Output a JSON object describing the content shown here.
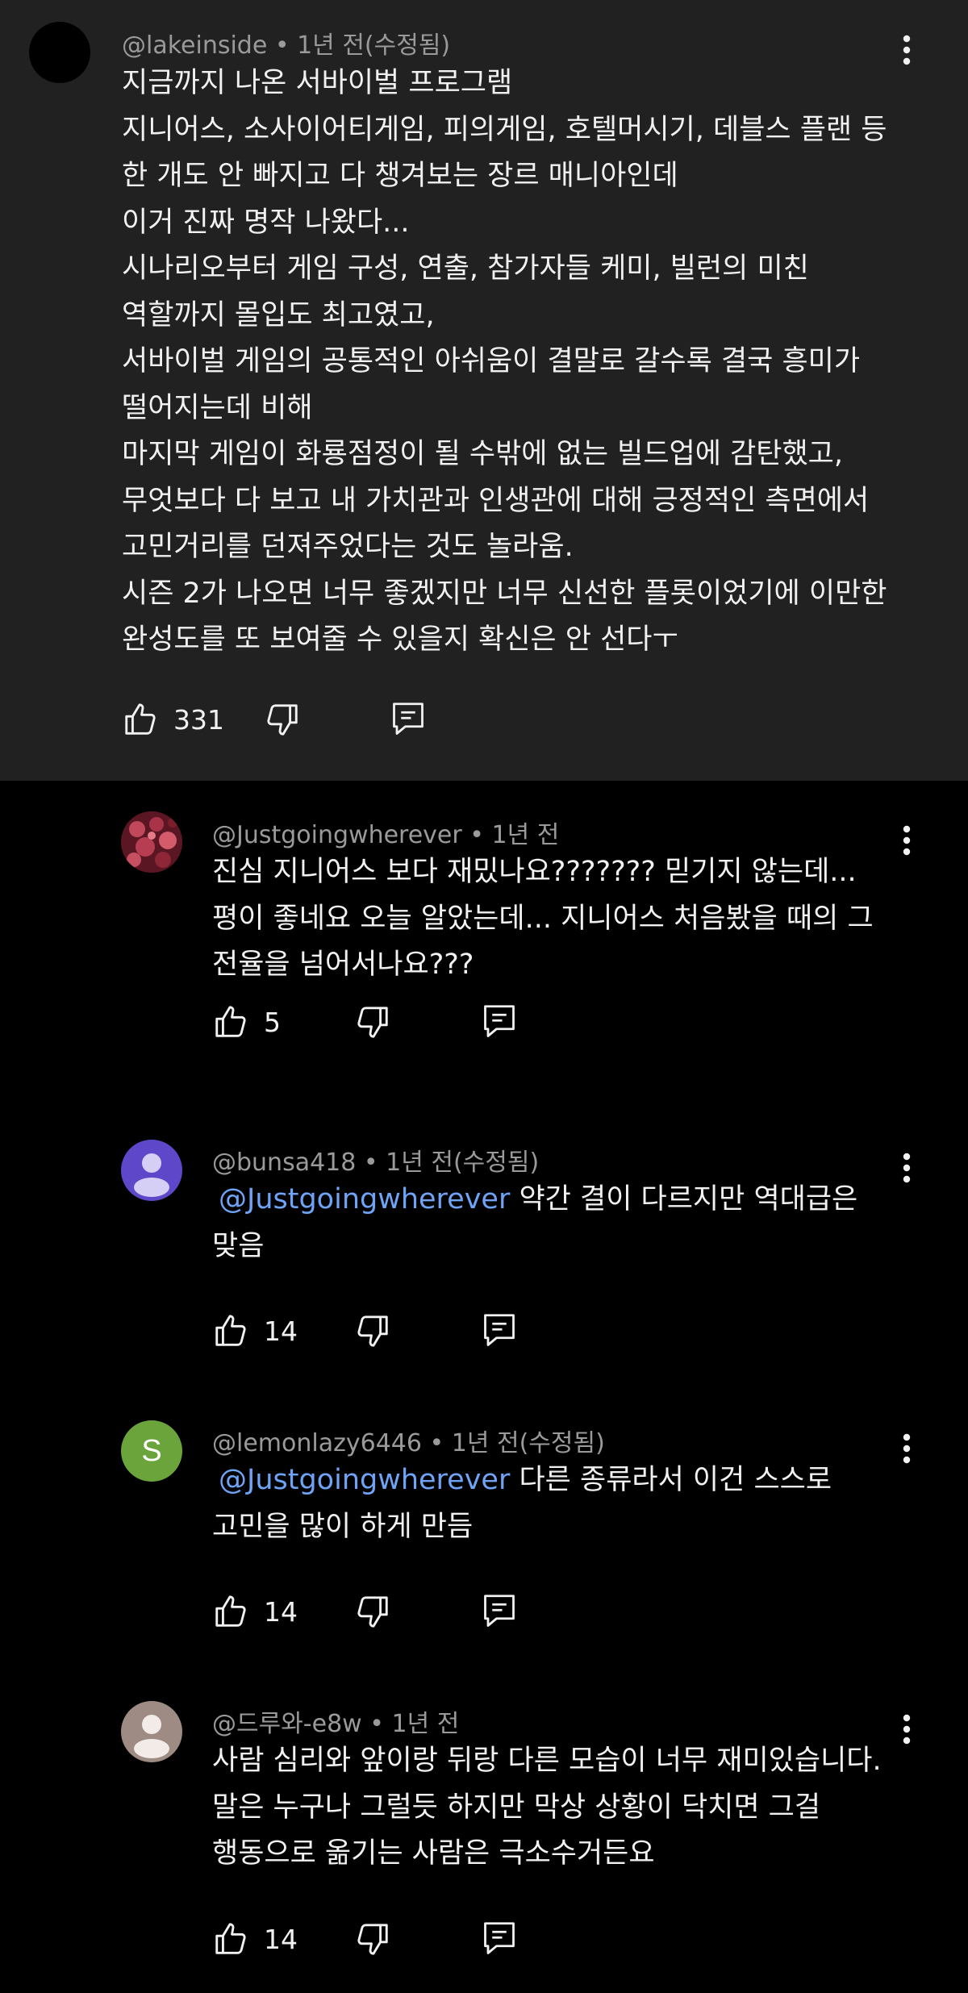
{
  "main_comment": {
    "handle": "@lakeinside",
    "time": "1년 전(수정됨)",
    "lines": [
      "지금까지 나온 서바이벌 프로그램",
      "지니어스, 소사이어티게임, 피의게임, 호텔머시기, 데블스 플랜 등",
      "한 개도 안 빠지고 다 챙겨보는 장르 매니아인데",
      "이거 진짜 명작 나왔다...",
      "시나리오부터 게임 구성, 연출, 참가자들 케미, 빌런의 미친",
      "역할까지 몰입도 최고였고,",
      "서바이벌 게임의 공통적인 아쉬움이 결말로 갈수록 결국 흥미가",
      "떨어지는데 비해",
      "마지막 게임이 화룡점정이 될 수밖에 없는 빌드업에 감탄했고,",
      "무엇보다 다 보고 내 가치관과 인생관에 대해 긍정적인 측면에서",
      "고민거리를 던져주었다는 것도 놀라움.",
      "시즌 2가 나오면 너무 좋겠지만 너무 신선한 플롯이었기에 이만한",
      "완성도를 또 보여줄 수 있을지 확신은 안 선다ㅜ"
    ],
    "likes": "331"
  },
  "replies": [
    {
      "handle": "@Justgoingwherever",
      "time": "1년 전",
      "lines": [
        "진심 지니어스 보다 재밌나요??????? 믿기지 않는데...",
        "평이 좋네요 오늘 알았는데... 지니어스 처음봤을 때의 그",
        "전율을 넘어서나요???"
      ],
      "likes": "5"
    },
    {
      "handle": "@bunsa418",
      "time": "1년 전(수정됨)",
      "mention": "@Justgoingwherever",
      "first_line_rest": " 약간 결이 다르지만 역대급은",
      "lines": [
        "맞음"
      ],
      "likes": "14",
      "avatar_letter": ""
    },
    {
      "handle": "@lemonlazy6446",
      "time": "1년 전(수정됨)",
      "mention": "@Justgoingwherever",
      "first_line_rest": "  다른 종류라서 이건 스스로",
      "lines": [
        "고민을 많이 하게 만듬"
      ],
      "likes": "14",
      "avatar_letter": "S"
    },
    {
      "handle": "@드루와-e8w",
      "time": "1년 전",
      "lines": [
        "사람 심리와 앞이랑 뒤랑 다른 모습이 너무 재미있습니다.",
        "말은 누구나 그럴듯 하지만 막상 상황이 닥치면 그걸",
        "행동으로 옮기는 사람은 극소수거든요"
      ],
      "likes": "14"
    }
  ],
  "separator": "•",
  "colors": {
    "main_bg": "#212121",
    "page_bg": "#000000",
    "mention": "#6ea3f5",
    "meta": "#9a9a9a",
    "avatar_purple": "#5e48c9",
    "avatar_green": "#6aa43b",
    "avatar_grey": "#9e8c84"
  },
  "icons": [
    "more-vert-icon",
    "thumb-up-icon",
    "thumb-down-icon",
    "reply-icon",
    "person-icon"
  ]
}
